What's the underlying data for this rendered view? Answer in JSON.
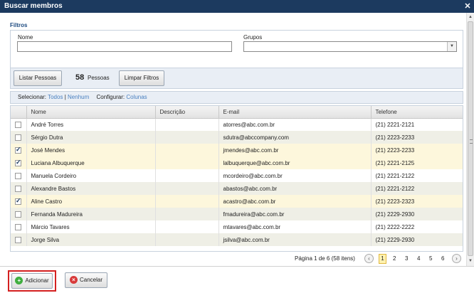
{
  "window": {
    "title": "Buscar membros",
    "close": "✕"
  },
  "filters": {
    "label": "Filtros",
    "name_label": "Nome",
    "name_value": "",
    "groups_label": "Grupos",
    "groups_value": ""
  },
  "actions": {
    "list_button": "Listar Pessoas",
    "count": "58",
    "count_label": "Pessoas",
    "clear_button": "Limpar Filtros"
  },
  "selection": {
    "select_label": "Selecionar:",
    "all": "Todos",
    "separator": "|",
    "none": "Nenhum",
    "configure_label": "Configurar:",
    "columns": "Colunas"
  },
  "table": {
    "headers": [
      "Nome",
      "Descrição",
      "E-mail",
      "Telefone"
    ],
    "rows": [
      {
        "name": "André Torres",
        "description": "",
        "email": "atorres@abc.com.br",
        "phone": "(21) 2221-2121",
        "checked": false
      },
      {
        "name": "Sérgio Dutra",
        "description": "",
        "email": "sdutra@abccompany.com",
        "phone": "(21) 2223-2233",
        "checked": false
      },
      {
        "name": "José Mendes",
        "description": "",
        "email": "jmendes@abc.com.br",
        "phone": "(21) 2223-2233",
        "checked": true
      },
      {
        "name": "Luciana Albuquerque",
        "description": "",
        "email": "lalbuquerque@abc.com.br",
        "phone": "(21) 2221-2125",
        "checked": true
      },
      {
        "name": "Manuela Cordeiro",
        "description": "",
        "email": "mcordeiro@abc.com.br",
        "phone": "(21) 2221-2122",
        "checked": false
      },
      {
        "name": "Alexandre Bastos",
        "description": "",
        "email": "abastos@abc.com.br",
        "phone": "(21) 2221-2122",
        "checked": false
      },
      {
        "name": "Aline Castro",
        "description": "",
        "email": "acastro@abc.com.br",
        "phone": "(21) 2223-2323",
        "checked": true
      },
      {
        "name": "Fernanda Madureira",
        "description": "",
        "email": "fmadureira@abc.com.br",
        "phone": "(21) 2229-2930",
        "checked": false
      },
      {
        "name": "Márcio Tavares",
        "description": "",
        "email": "mtavares@abc.com.br",
        "phone": "(21) 2222-2222",
        "checked": false
      },
      {
        "name": "Jorge Silva",
        "description": "",
        "email": "jsilva@abc.com.br",
        "phone": "(21) 2229-2930",
        "checked": false
      }
    ]
  },
  "pager": {
    "info": "Página 1 de 6 (58 itens)",
    "prev": "‹",
    "next": "›",
    "pages": [
      "1",
      "2",
      "3",
      "4",
      "5",
      "6"
    ],
    "current": "1"
  },
  "footer": {
    "add_label": "Adicionar",
    "cancel_label": "Cancelar"
  },
  "colors": {
    "titlebar": "#1c3a5f",
    "link": "#4a80c0",
    "selected_row": "#fdf7dc",
    "highlight_border": "#d42020"
  }
}
